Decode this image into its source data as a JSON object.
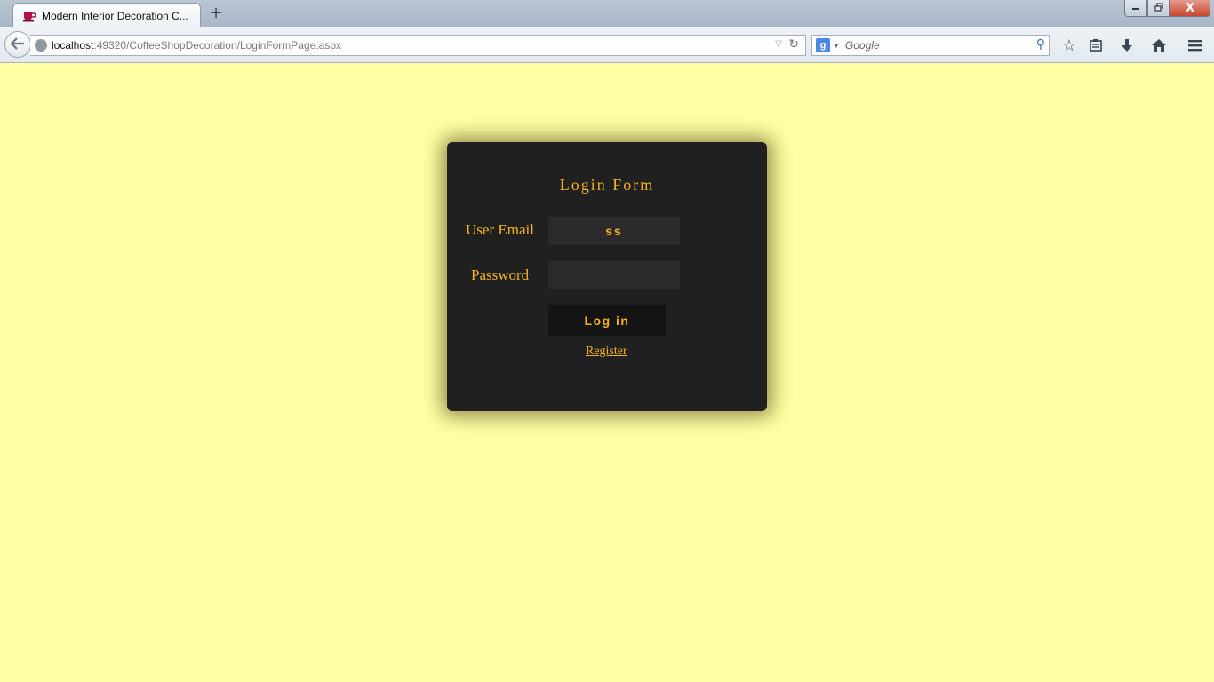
{
  "browser": {
    "tab": {
      "title": "Modern Interior Decoration C...",
      "favicon": "coffee-cup-icon"
    },
    "new_tab_label": "+",
    "window_controls": {
      "minimize": "minimize-icon",
      "maximize": "restore-icon",
      "close_label": "X"
    },
    "address": {
      "host": "localhost",
      "path": ":49320/CoffeeShopDecoration/LoginFormPage.aspx"
    },
    "search": {
      "engine": "Google",
      "placeholder": "Google"
    },
    "toolbar_icons": [
      "bookmark-star-icon",
      "reading-list-icon",
      "downloads-icon",
      "home-icon",
      "menu-icon"
    ]
  },
  "login": {
    "title": "Login Form",
    "email_label": "User Email",
    "email_value": "ss",
    "password_label": "Password",
    "password_value": "",
    "submit_label": "Log in",
    "register_label": "Register"
  },
  "colors": {
    "page_background": "#ffffa3",
    "card_background": "#202020",
    "accent": "#f7b21d"
  }
}
